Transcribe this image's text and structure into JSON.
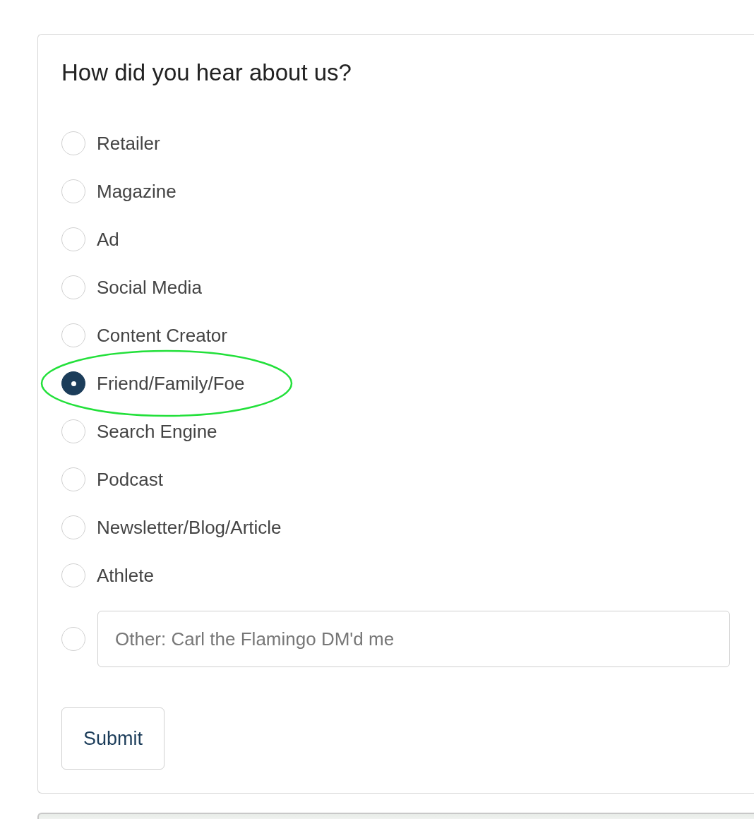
{
  "question": "How did you hear about us?",
  "options": [
    {
      "label": "Retailer",
      "selected": false,
      "highlighted": false
    },
    {
      "label": "Magazine",
      "selected": false,
      "highlighted": false
    },
    {
      "label": "Ad",
      "selected": false,
      "highlighted": false
    },
    {
      "label": "Social Media",
      "selected": false,
      "highlighted": false
    },
    {
      "label": "Content Creator",
      "selected": false,
      "highlighted": false
    },
    {
      "label": "Friend/Family/Foe",
      "selected": true,
      "highlighted": true
    },
    {
      "label": "Search Engine",
      "selected": false,
      "highlighted": false
    },
    {
      "label": "Podcast",
      "selected": false,
      "highlighted": false
    },
    {
      "label": "Newsletter/Blog/Article",
      "selected": false,
      "highlighted": false
    },
    {
      "label": "Athlete",
      "selected": false,
      "highlighted": false
    }
  ],
  "other": {
    "selected": false,
    "value": "Other: Carl the Flamingo DM'd me"
  },
  "submit": "Submit"
}
